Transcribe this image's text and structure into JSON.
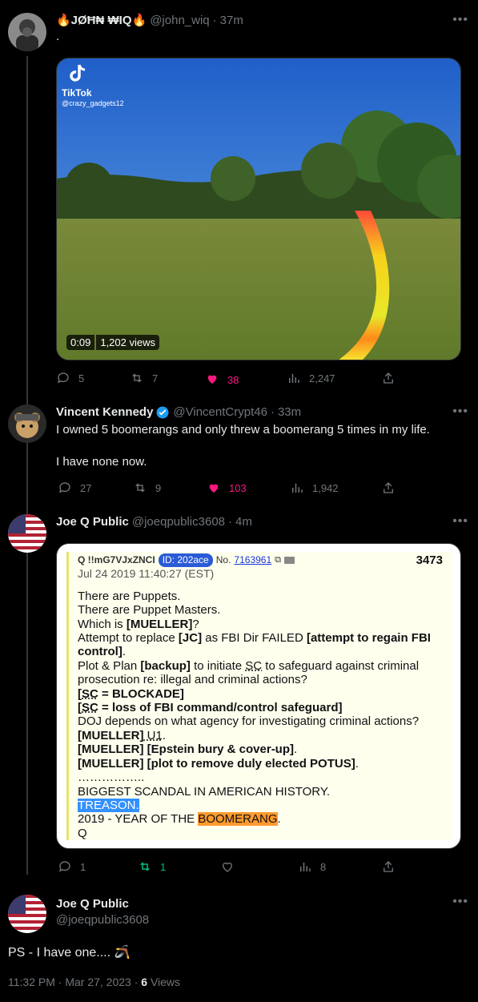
{
  "colors": {
    "background": "#000000",
    "text": "#e7e9ea",
    "muted": "#71767b",
    "like": "#f91880",
    "retweet": "#00ba7c",
    "verified": "#1d9bf0"
  },
  "tweet1": {
    "name": "🔥JØĦ₦ ₩IQ🔥",
    "handle": "@john_wiq",
    "time": "37m",
    "dot": "·",
    "text": ".",
    "video": {
      "brand": "TikTok",
      "account": "@crazy_gadgets12",
      "duration": "0:09",
      "views": "1,202 views"
    },
    "actions": {
      "replies": "5",
      "retweets": "7",
      "likes": "38",
      "views": "2,247"
    }
  },
  "tweet2": {
    "name": "Vincent Kennedy",
    "handle": "@VincentCrypt46",
    "time": "33m",
    "dot": "·",
    "line1": "I owned 5 boomerangs and only threw a boomerang 5 times in my life.",
    "line2": "I have none now.",
    "actions": {
      "replies": "27",
      "retweets": "9",
      "likes": "103",
      "views": "1,942"
    }
  },
  "tweet3": {
    "name": "Joe Q Public",
    "handle": "@joeqpublic3608",
    "time": "4m",
    "dot": "·",
    "qdrop": {
      "author": "Q !!mG7VJxZNCI",
      "id": "ID: 202ace",
      "no_label": "No.",
      "no": "7163961",
      "date": "Jul 24 2019 11:40:27 (EST)",
      "number": "3473",
      "l1": "There are Puppets.",
      "l2": "There are Puppet Masters.",
      "l3a": "Which is ",
      "l3b": "[MUELLER]",
      "l3c": "?",
      "l4a": "Attempt to replace ",
      "l4b": "[JC]",
      "l4c": " as FBI Dir FAILED ",
      "l4d": "[attempt to regain FBI control]",
      "l4e": ".",
      "l5a": "Plot & Plan ",
      "l5b": "[backup]",
      "l5c": " to initiate ",
      "l5d": "SC",
      "l5e": " to safeguard against criminal prosecution re: illegal and criminal actions?",
      "l6a": "[",
      "l6b": "SC",
      "l6c": " = BLOCKADE]",
      "l7a": "[",
      "l7b": "SC",
      "l7c": " = loss of FBI command/control safeguard]",
      "l8": "DOJ depends on what agency for investigating criminal actions?",
      "l9a": "[MUELLER]",
      "l9b": " U1",
      "l10a": "[MUELLER] [Epstein bury & cover-up]",
      "l10b": ".",
      "l11a": "[MUELLER] [plot to remove duly elected POTUS]",
      "l11b": ".",
      "l12": "……………..",
      "l13": "BIGGEST SCANDAL IN AMERICAN HISTORY.",
      "l14": "TREASON.",
      "l15a": "2019 - YEAR OF THE ",
      "l15b": "BOOMERANG",
      "l15c": ".",
      "l16": "Q"
    },
    "actions": {
      "replies": "1",
      "retweets": "1",
      "likes": "",
      "views": "8"
    }
  },
  "tweet4": {
    "name": "Joe Q Public",
    "handle": "@joeqpublic3608",
    "text": "PS - I have one.... 🪃",
    "timestamp": "11:32 PM · Mar 27, 2023 · ",
    "views_count": "6",
    "views_label": " Views"
  }
}
